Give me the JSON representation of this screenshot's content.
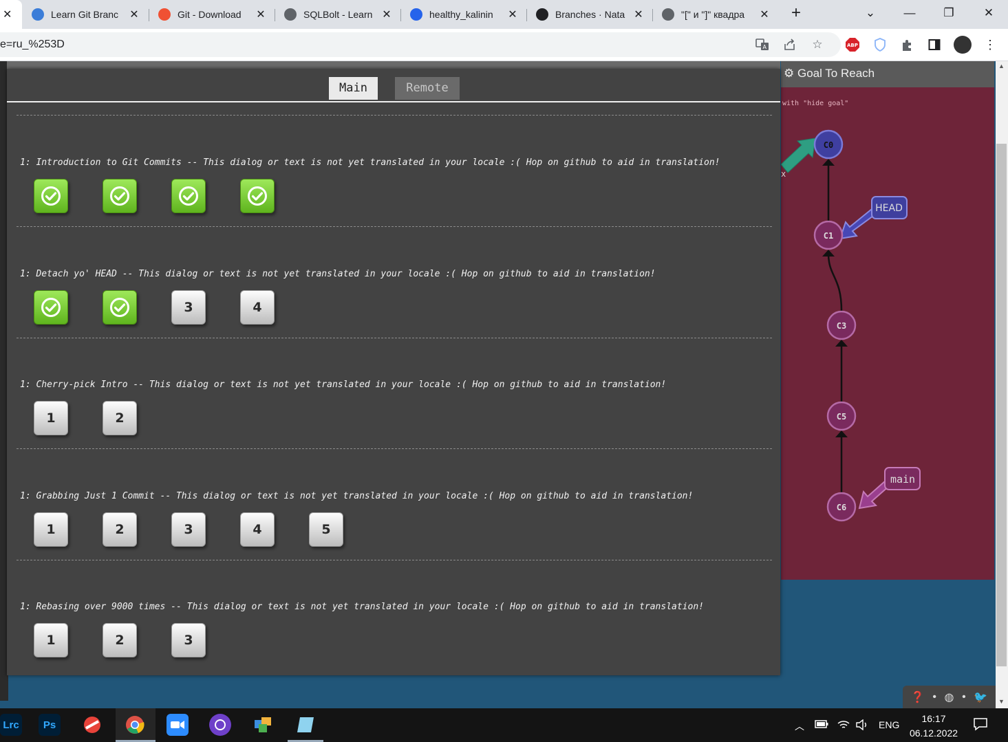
{
  "browser": {
    "tabs": [
      {
        "title": "Learn Git Branc",
        "favicon": "learngit-icon",
        "color": "#3b7dd8"
      },
      {
        "title": "Git - Download",
        "favicon": "git-icon",
        "color": "#f05133"
      },
      {
        "title": "SQLBolt - Learn",
        "favicon": "database-icon",
        "color": "#5f6368"
      },
      {
        "title": "healthy_kalinin",
        "favicon": "c-icon",
        "color": "#2563eb"
      },
      {
        "title": "Branches · Nata",
        "favicon": "github-icon",
        "color": "#202124"
      },
      {
        "title": "\"[\" и \"]\" квадра",
        "favicon": "globe-icon",
        "color": "#5f6368"
      }
    ],
    "new_tab_label": "+",
    "address": "e=ru_%253D"
  },
  "dialog": {
    "tabs": {
      "main": "Main",
      "remote": "Remote"
    },
    "sequences": [
      {
        "title": "1: Introduction to Git Commits -- This dialog or text is not yet translated in your locale :( Hop on github to aid in translation!",
        "levels": [
          {
            "label": "",
            "solved": true
          },
          {
            "label": "",
            "solved": true
          },
          {
            "label": "",
            "solved": true
          },
          {
            "label": "",
            "solved": true
          }
        ]
      },
      {
        "title": "1: Detach yo' HEAD -- This dialog or text is not yet translated in your locale :( Hop on github to aid in translation!",
        "levels": [
          {
            "label": "",
            "solved": true
          },
          {
            "label": "",
            "solved": true
          },
          {
            "label": "3",
            "solved": false
          },
          {
            "label": "4",
            "solved": false
          }
        ]
      },
      {
        "title": "1: Cherry-pick Intro -- This dialog or text is not yet translated in your locale :( Hop on github to aid in translation!",
        "levels": [
          {
            "label": "1",
            "solved": false
          },
          {
            "label": "2",
            "solved": false
          }
        ]
      },
      {
        "title": "1: Grabbing Just 1 Commit -- This dialog or text is not yet translated in your locale :( Hop on github to aid in translation!",
        "levels": [
          {
            "label": "1",
            "solved": false
          },
          {
            "label": "2",
            "solved": false
          },
          {
            "label": "3",
            "solved": false
          },
          {
            "label": "4",
            "solved": false
          },
          {
            "label": "5",
            "solved": false
          }
        ]
      },
      {
        "title": "1: Rebasing over 9000 times -- This dialog or text is not yet translated in your locale :( Hop on github to aid in translation!",
        "levels": [
          {
            "label": "1",
            "solved": false
          },
          {
            "label": "2",
            "solved": false
          },
          {
            "label": "3",
            "solved": false
          }
        ]
      }
    ]
  },
  "goal": {
    "header": "Goal To Reach",
    "hint": "with \"hide goal\"",
    "commits": [
      "C0",
      "C1",
      "C3",
      "C5",
      "C6"
    ],
    "branches": {
      "head": "HEAD",
      "main": "main",
      "partial": "x"
    }
  },
  "taskbar": {
    "apps": [
      "Lrc",
      "Ps"
    ],
    "language": "ENG",
    "time": "16:17",
    "date": "06.12.2022"
  },
  "colors": {
    "dialog_bg": "#434343",
    "solved_green": "#6cc52a",
    "goal_panel": "#6e2439",
    "commit_fill": "#7a2a5e",
    "head_branch": "#3f3f9e",
    "main_branch": "#9a3f8e"
  }
}
